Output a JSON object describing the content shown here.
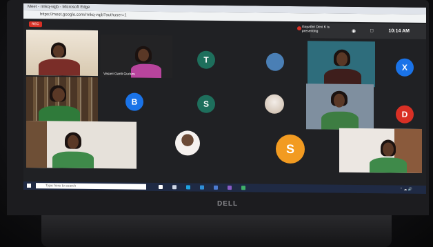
{
  "browser": {
    "title_text": "Meet - rmkq-vqjb - Microsoft Edge",
    "address": "https://meet.google.com/rmkq-vqjb?authuser=1"
  },
  "meet": {
    "recording_badge": "REC",
    "presenter_label": "Gayathri Devi K is presenting",
    "time": "10:14 AM",
    "participant_tile_name": "Vasavi Ganti Guduru",
    "avatars": [
      {
        "letter": "T",
        "color": "#1e6f5c"
      },
      {
        "letter": "",
        "color": "#4a7fb5"
      },
      {
        "letter": "X",
        "color": "#1a73e8"
      },
      {
        "letter": "B",
        "color": "#1a73e8"
      },
      {
        "letter": "S",
        "color": "#1e6f5c"
      },
      {
        "letter": "D",
        "color": "#d93025"
      },
      {
        "letter": "S",
        "color": "#f29b21"
      }
    ]
  },
  "taskbar": {
    "search_placeholder": "Type here to search"
  },
  "laptop": {
    "brand": "DELL"
  }
}
